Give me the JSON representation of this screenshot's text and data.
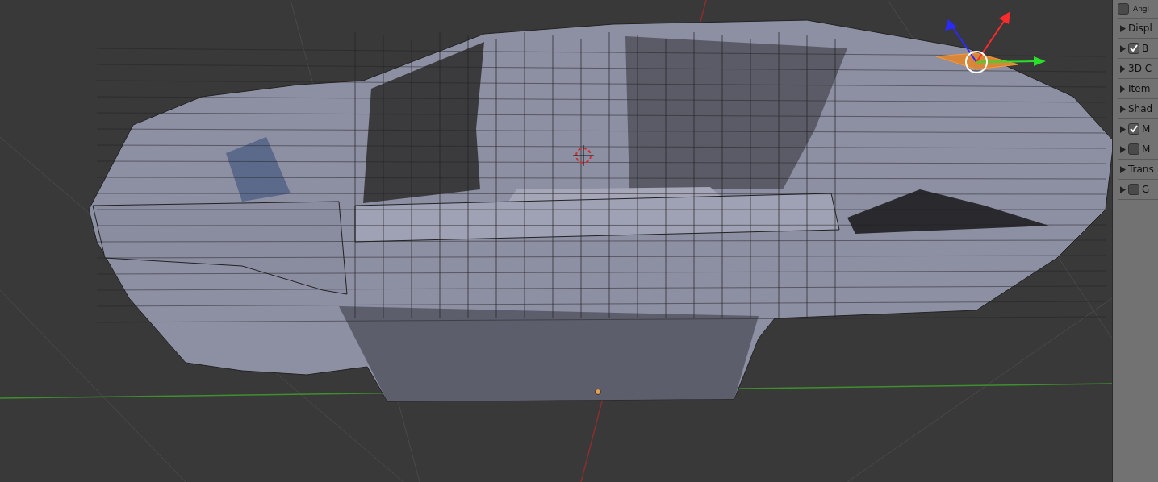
{
  "properties_panel": {
    "top_option": {
      "label": "Angl",
      "checked": false
    },
    "panels": [
      {
        "kind": "plain",
        "label": "Displ"
      },
      {
        "kind": "check",
        "label": "B",
        "checked": true
      },
      {
        "kind": "plain",
        "label": "3D C"
      },
      {
        "kind": "plain",
        "label": "Item"
      },
      {
        "kind": "plain",
        "label": "Shad"
      },
      {
        "kind": "check",
        "label": "M",
        "checked": true
      },
      {
        "kind": "check",
        "label": "M",
        "checked": false
      },
      {
        "kind": "plain",
        "label": "Trans"
      },
      {
        "kind": "check",
        "label": "G",
        "checked": false
      }
    ]
  }
}
